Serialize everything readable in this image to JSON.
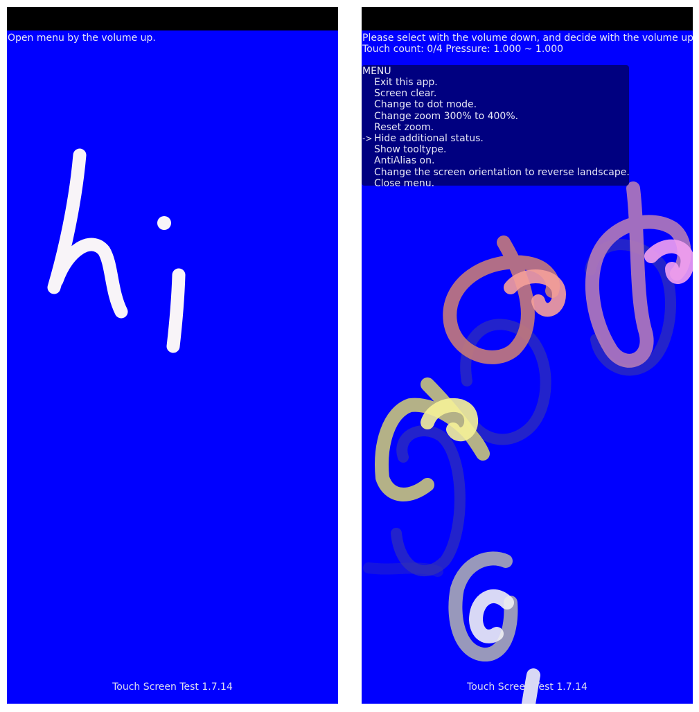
{
  "left_screen": {
    "hint": "Open menu by the volume up.",
    "footer": "Touch Screen Test 1.7.14"
  },
  "right_screen": {
    "instruction": "Please select with the volume down, and decide with the volume up.",
    "touch_status": "Touch count: 0/4 Pressure: 1.000 ~ 1.000",
    "menu_title": "MENU",
    "selected_marker": "->",
    "menu_items": [
      {
        "label": "Exit this app.",
        "selected": false
      },
      {
        "label": "Screen clear.",
        "selected": false
      },
      {
        "label": "Change to dot mode.",
        "selected": false
      },
      {
        "label": "Change zoom 300% to 400%.",
        "selected": false
      },
      {
        "label": "Reset zoom.",
        "selected": false
      },
      {
        "label": "Hide additional status.",
        "selected": true
      },
      {
        "label": "Show tooltype.",
        "selected": false
      },
      {
        "label": "AntiAlias on.",
        "selected": false
      },
      {
        "label": "Change the screen orientation to reverse landscape.",
        "selected": false
      },
      {
        "label": "Close menu.",
        "selected": false
      }
    ],
    "footer": "Touch Screen Test 1.7.14"
  },
  "colors": {
    "canvas": "#0000ff",
    "status_bar": "#000000",
    "menu_background": "#000080",
    "text": "#e6e6f5",
    "handwriting": "#f8f4f8",
    "stroke_salmon": "#c47a7a",
    "stroke_salmon_tip": "#f5a09a",
    "stroke_mauve": "#b27ab8",
    "stroke_pink_tip": "#f2a0f0",
    "stroke_yellow": "#c8c47a",
    "stroke_yellow_tip": "#f5f298",
    "stroke_gray": "#a8a8b4",
    "stroke_white_tip": "#f0f0f4",
    "shadow": "#3a3aa8"
  }
}
